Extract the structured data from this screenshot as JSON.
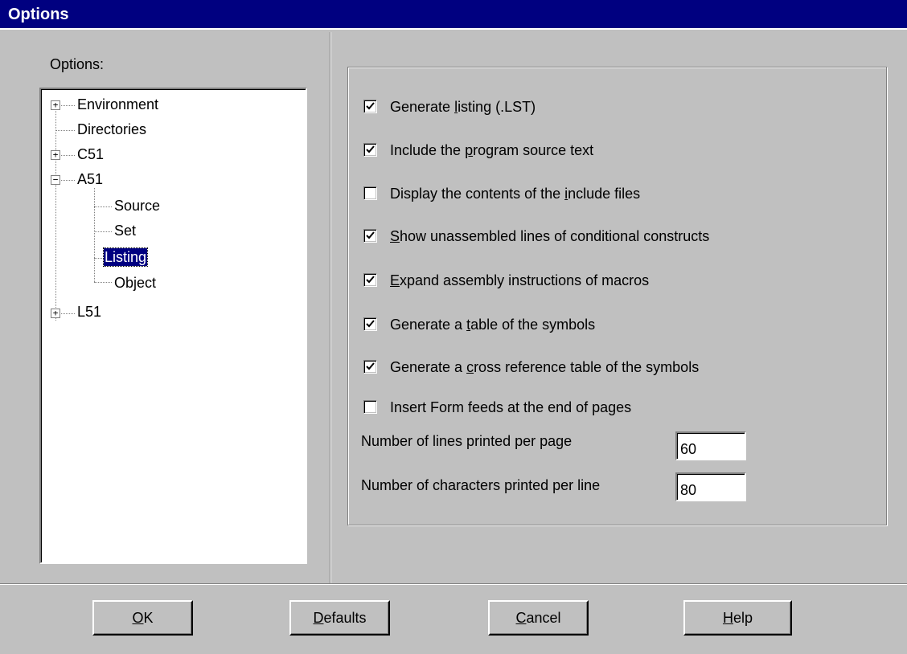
{
  "window": {
    "title": "Options"
  },
  "tree": {
    "label": "Options:",
    "items": [
      {
        "label": "Environment",
        "expander": "+"
      },
      {
        "label": "Directories"
      },
      {
        "label": "C51",
        "expander": "+"
      },
      {
        "label": "A51",
        "expander": "−"
      },
      {
        "label": "Source"
      },
      {
        "label": "Set"
      },
      {
        "label": "Listing",
        "selected": true
      },
      {
        "label": "Object"
      },
      {
        "label": "L51",
        "expander": "+"
      }
    ]
  },
  "options": [
    {
      "pre": "Generate ",
      "key": "l",
      "post": "isting (.LST)",
      "checked": true
    },
    {
      "pre": "Include the ",
      "key": "p",
      "post": "rogram source text",
      "checked": true
    },
    {
      "pre": "Display the contents of the ",
      "key": "i",
      "post": "nclude files",
      "checked": false
    },
    {
      "pre": "",
      "key": "S",
      "post": "how unassembled lines of conditional constructs",
      "checked": true
    },
    {
      "pre": "",
      "key": "E",
      "post": "xpand assembly instructions of macros",
      "checked": true
    },
    {
      "pre": "Generate a ",
      "key": "t",
      "post": "able of the symbols",
      "checked": true
    },
    {
      "pre": "Generate a ",
      "key": "c",
      "post": "ross reference table of the symbols",
      "checked": true
    },
    {
      "pre": "Insert Form feeds at the end of pages",
      "key": "",
      "post": "",
      "checked": false
    }
  ],
  "fields": {
    "lines_label": "Number of lines printed per page",
    "lines_value": "60",
    "chars_label": "Number of characters printed per line",
    "chars_value": "80"
  },
  "buttons": {
    "ok": {
      "key": "O",
      "rest": "K"
    },
    "defaults": {
      "key": "D",
      "rest": "efaults"
    },
    "cancel": {
      "key": "C",
      "rest": "ancel"
    },
    "help": {
      "key": "H",
      "rest": "elp"
    }
  },
  "colors": {
    "titlebar": "#000080",
    "face": "#c0c0c0",
    "selection": "#000080"
  }
}
